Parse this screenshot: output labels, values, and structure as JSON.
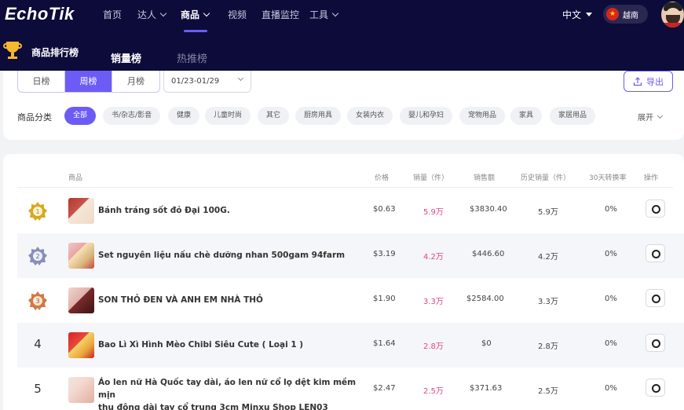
{
  "brand": {
    "logo": "EchoTik"
  },
  "nav": {
    "items": [
      {
        "label": "首页"
      },
      {
        "label": "达人"
      },
      {
        "label": "商品"
      },
      {
        "label": "视频"
      },
      {
        "label": "直播监控"
      },
      {
        "label": "工具"
      }
    ],
    "active": "商品",
    "language": "中文",
    "region": "越南"
  },
  "subnav": {
    "title": "商品排行榜",
    "tabs": [
      {
        "label": "销量榜"
      },
      {
        "label": "热推榜"
      }
    ],
    "active_tab": "销量榜"
  },
  "filters": {
    "periods": [
      {
        "label": "日榜"
      },
      {
        "label": "周榜"
      },
      {
        "label": "月榜"
      }
    ],
    "active_period": "周榜",
    "date_range": "01/23-01/29",
    "export_label": "导出",
    "category_label": "商品分类",
    "categories": [
      {
        "label": "全部"
      },
      {
        "label": "书/杂志/影音"
      },
      {
        "label": "健康"
      },
      {
        "label": "儿童时尚"
      },
      {
        "label": "其它"
      },
      {
        "label": "厨房用具"
      },
      {
        "label": "女装内衣"
      },
      {
        "label": "婴儿和孕妇"
      },
      {
        "label": "宠物用品"
      },
      {
        "label": "家具"
      },
      {
        "label": "家居用品"
      }
    ],
    "active_category": "全部",
    "expand_label": "展开"
  },
  "table": {
    "headers": {
      "product": "商品",
      "price": "价格",
      "sales": "销量（件）",
      "revenue": "销售额",
      "history": "历史销量（件）",
      "conversion": "30天转换率",
      "action": "操作"
    },
    "rows": [
      {
        "rank": "1",
        "medal": "gold",
        "name": "Bánh tráng sốt đỏ Đại 100G.",
        "price": "$0.63",
        "sales": "5.9万",
        "revenue": "$3830.40",
        "history": "5.9万",
        "conversion": "0%"
      },
      {
        "rank": "2",
        "medal": "silver",
        "name": "Set nguyên liệu nấu chè dưỡng nhan 500gam 94farm",
        "price": "$3.19",
        "sales": "4.2万",
        "revenue": "$446.60",
        "history": "4.2万",
        "conversion": "0%"
      },
      {
        "rank": "3",
        "medal": "bronze",
        "name": "SON THỎ ĐEN VÀ ANH EM NHÀ THỎ",
        "price": "$1.90",
        "sales": "3.3万",
        "revenue": "$2584.00",
        "history": "3.3万",
        "conversion": "0%"
      },
      {
        "rank": "4",
        "medal": "",
        "name": "Bao Lì Xì Hình Mèo Chibi Siêu Cute ( Loại 1 )",
        "price": "$1.64",
        "sales": "2.8万",
        "revenue": "$0",
        "history": "2.8万",
        "conversion": "0%"
      },
      {
        "rank": "5",
        "medal": "",
        "name_line1": "Áo len nữ Hà Quốc tay dài, áo len nữ cổ lọ dệt kim mềm mịn",
        "name_line2": "thu đông dài tay cổ trung 3cm Minxu Shop LEN03",
        "price": "$2.47",
        "sales": "2.5万",
        "revenue": "$371.63",
        "history": "2.5万",
        "conversion": "0%"
      }
    ]
  },
  "colors": {
    "accent": "#6c5cf5",
    "nav_bg": "#0d0b3a",
    "sales_pink": "#e0468a",
    "gold": "#d9a81e",
    "silver": "#8a8fb8",
    "bronze": "#d07a45"
  },
  "icons": {
    "trophy": "trophy-icon",
    "export": "upload-icon",
    "action": "search-icon",
    "rank_medal": "medal-icon",
    "dropdown": "chevron-down-icon"
  }
}
